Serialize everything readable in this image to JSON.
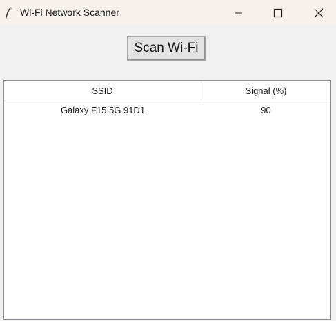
{
  "window": {
    "title": "Wi-Fi Network Scanner",
    "icon": "feather-icon",
    "controls": [
      "minimize-icon",
      "maximize-icon",
      "close-icon"
    ]
  },
  "toolbar": {
    "scan_label": "Scan Wi-Fi"
  },
  "table": {
    "columns": [
      "SSID",
      "Signal (%)"
    ],
    "rows": [
      {
        "ssid": "Galaxy F15 5G 91D1",
        "signal": "90"
      }
    ]
  }
}
